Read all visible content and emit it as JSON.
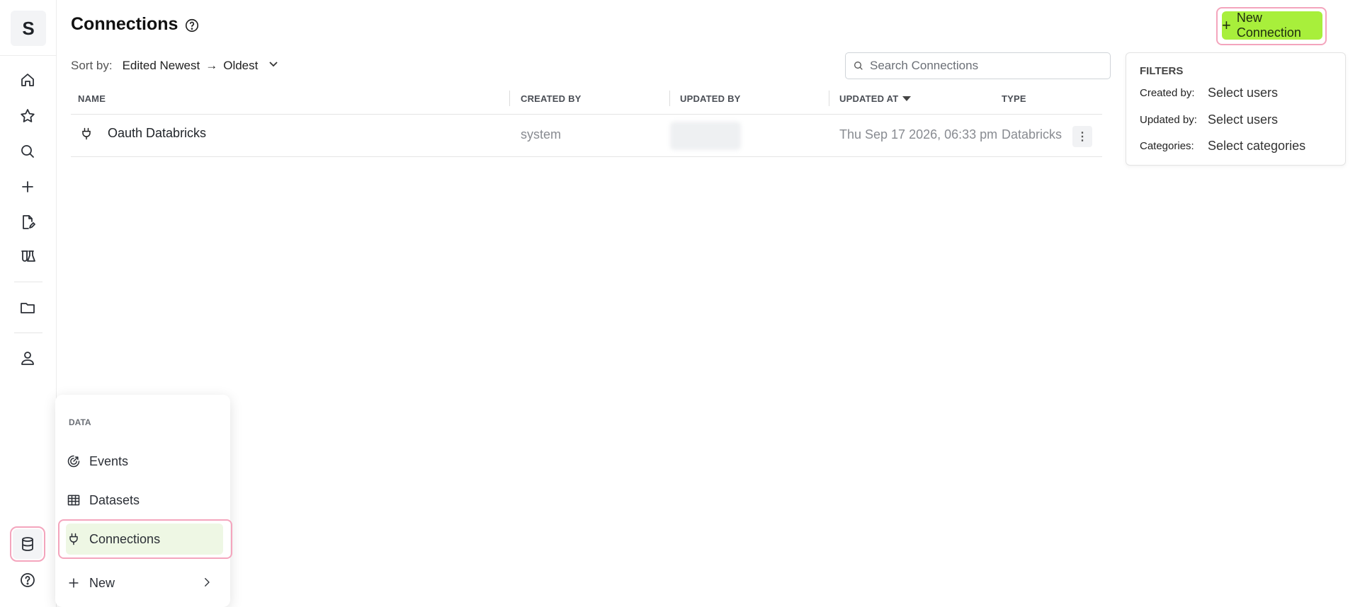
{
  "app": {
    "logo_letter": "S",
    "page_title": "Connections"
  },
  "header": {
    "new_button_label": "New Connection"
  },
  "sort": {
    "label": "Sort by:",
    "from": "Edited Newest",
    "to": "Oldest"
  },
  "search": {
    "placeholder": "Search Connections"
  },
  "table": {
    "columns": [
      "NAME",
      "CREATED BY",
      "UPDATED BY",
      "UPDATED AT",
      "TYPE"
    ],
    "rows": [
      {
        "name": "Oauth Databricks",
        "created_by": "system",
        "updated_by": "",
        "updated_at": "Thu Sep 17 2026, 06:33 pm",
        "type": "Databricks"
      }
    ]
  },
  "filters": {
    "title": "FILTERS",
    "created_by_label": "Created by:",
    "created_by_value": "Select users",
    "updated_by_label": "Updated by:",
    "updated_by_value": "Select users",
    "categories_label": "Categories:",
    "categories_value": "Select categories"
  },
  "data_menu": {
    "heading": "DATA",
    "items": [
      {
        "label": "Events",
        "icon": "events-icon"
      },
      {
        "label": "Datasets",
        "icon": "table-icon"
      },
      {
        "label": "Connections",
        "icon": "plug-icon"
      },
      {
        "label": "New",
        "icon": "plus-icon"
      }
    ]
  },
  "colors": {
    "accent_green": "#a8ef3b",
    "highlight_pink": "#f4a5bd",
    "active_item_bg": "#eef7e4"
  }
}
